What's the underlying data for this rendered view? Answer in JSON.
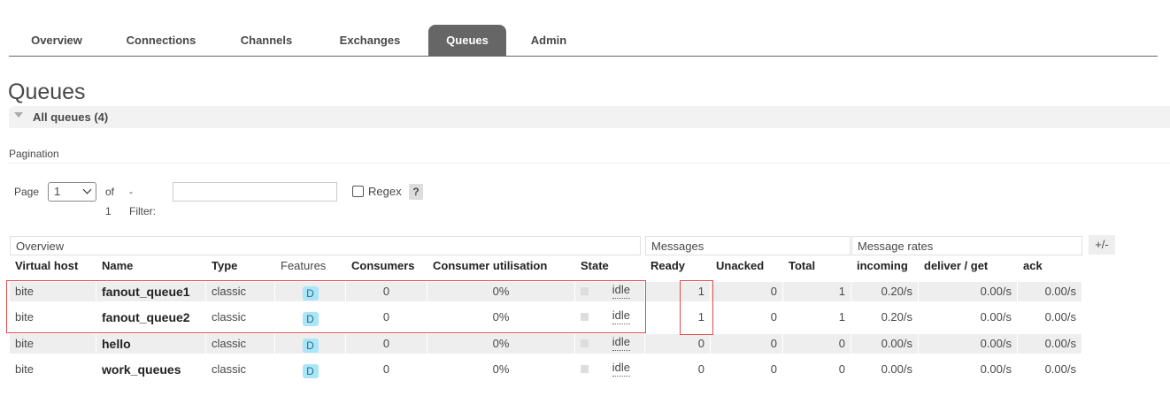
{
  "nav": {
    "tabs": [
      {
        "label": "Overview"
      },
      {
        "label": "Connections"
      },
      {
        "label": "Channels"
      },
      {
        "label": "Exchanges"
      },
      {
        "label": "Queues",
        "active": true
      },
      {
        "label": "Admin"
      }
    ]
  },
  "page": {
    "title": "Queues",
    "section_title": "All queues (4)"
  },
  "pagination": {
    "label": "Pagination",
    "page_label": "Page",
    "page_value": "1",
    "of_label": "of 1",
    "filter_label": "- Filter:",
    "filter_value": "",
    "regex_label": "Regex",
    "help": "?"
  },
  "table": {
    "groups": {
      "overview": "Overview",
      "messages": "Messages",
      "message_rates": "Message rates"
    },
    "toggle_columns": "+/-",
    "headers": {
      "virtual_host": "Virtual host",
      "name": "Name",
      "type": "Type",
      "features": "Features",
      "consumers": "Consumers",
      "consumer_utilisation": "Consumer utilisation",
      "state": "State",
      "ready": "Ready",
      "unacked": "Unacked",
      "total": "Total",
      "incoming": "incoming",
      "deliver_get": "deliver / get",
      "ack": "ack"
    },
    "rows": [
      {
        "vhost": "bite",
        "name": "fanout_queue1",
        "type": "classic",
        "feature": "D",
        "consumers": "0",
        "utilisation": "0%",
        "state": "idle",
        "ready": "1",
        "unacked": "0",
        "total": "1",
        "incoming": "0.20/s",
        "deliver": "0.00/s",
        "ack": "0.00/s"
      },
      {
        "vhost": "bite",
        "name": "fanout_queue2",
        "type": "classic",
        "feature": "D",
        "consumers": "0",
        "utilisation": "0%",
        "state": "idle",
        "ready": "1",
        "unacked": "0",
        "total": "1",
        "incoming": "0.20/s",
        "deliver": "0.00/s",
        "ack": "0.00/s"
      },
      {
        "vhost": "bite",
        "name": "hello",
        "type": "classic",
        "feature": "D",
        "consumers": "0",
        "utilisation": "0%",
        "state": "idle",
        "ready": "0",
        "unacked": "0",
        "total": "0",
        "incoming": "0.00/s",
        "deliver": "0.00/s",
        "ack": "0.00/s"
      },
      {
        "vhost": "bite",
        "name": "work_queues",
        "type": "classic",
        "feature": "D",
        "consumers": "0",
        "utilisation": "0%",
        "state": "idle",
        "ready": "0",
        "unacked": "0",
        "total": "0",
        "incoming": "0.00/s",
        "deliver": "0.00/s",
        "ack": "0.00/s"
      }
    ]
  },
  "colors": {
    "nav_active_bg": "#666666",
    "feature_badge_bg": "#aae6f8",
    "highlight": "#e34c4c",
    "row_odd_bg": "#eeeeee"
  }
}
